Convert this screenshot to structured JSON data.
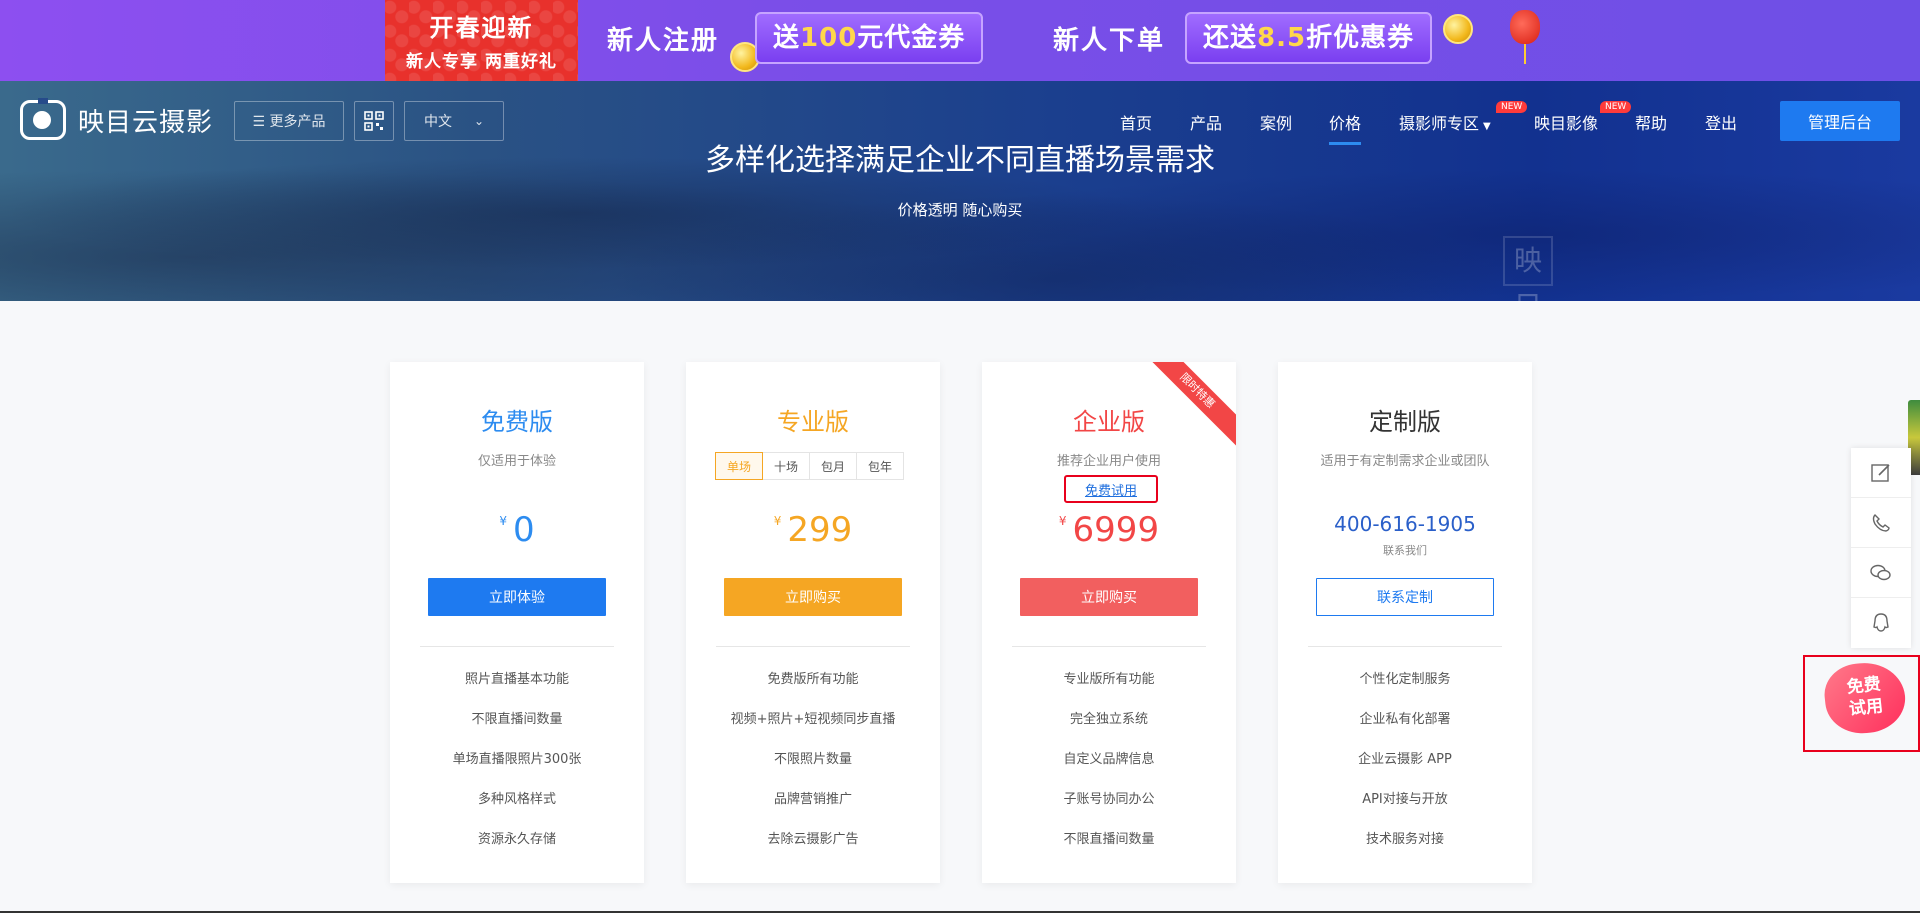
{
  "promo": {
    "badge_line1": "开春迎新",
    "badge_line2": "新人专享  两重好礼",
    "register_text": "新人注册",
    "register_pill_pre": "送",
    "register_pill_hl": "100",
    "register_pill_post": "元代金券",
    "order_text": "新人下单",
    "order_pill_pre": "还送",
    "order_pill_hl": "8.5",
    "order_pill_post": "折优惠券"
  },
  "nav": {
    "logo_text": "映目云摄影",
    "more_products": "☰ 更多产品",
    "qr_icon": "qr-code-icon",
    "language": "中文",
    "items": [
      {
        "label": "首页",
        "active": false
      },
      {
        "label": "产品",
        "active": false
      },
      {
        "label": "案例",
        "active": false
      },
      {
        "label": "价格",
        "active": true
      },
      {
        "label": "摄影师专区",
        "active": false,
        "badge": "NEW"
      },
      {
        "label": "映目影像",
        "active": false,
        "badge": "NEW"
      },
      {
        "label": "帮助",
        "active": false
      },
      {
        "label": "登出",
        "active": false
      }
    ],
    "admin_button": "管理后台"
  },
  "hero": {
    "title": "多样化选择满足企业不同直播场景需求",
    "subtitle": "价格透明 随心购买",
    "watermark": "映目"
  },
  "plans": [
    {
      "title": "免费版",
      "title_color": "#2d8cf0",
      "desc": "仅适用于体验",
      "currency": "¥",
      "price": "0",
      "price_color": "#2d8cf0",
      "button": "立即体验",
      "button_color": "#1e7af0",
      "features": [
        "照片直播基本功能",
        "不限直播间数量",
        "单场直播限照片300张",
        "多种风格样式",
        "资源永久存储"
      ]
    },
    {
      "title": "专业版",
      "title_color": "#f5a623",
      "tabs": [
        "单场",
        "十场",
        "包月",
        "包年"
      ],
      "selected_tab": "单场",
      "currency": "¥",
      "price": "299",
      "price_color": "#f5a623",
      "button": "立即购买",
      "button_color": "#f5a623",
      "features": [
        "免费版所有功能",
        "视频+照片+短视频同步直播",
        "不限照片数量",
        "品牌营销推广",
        "去除云摄影广告"
      ]
    },
    {
      "title": "企业版",
      "title_color": "#f24646",
      "desc": "推荐企业用户使用",
      "trial_link": "免费试用",
      "ribbon": "限时特惠",
      "currency": "¥",
      "price": "6999",
      "price_color": "#f24646",
      "button": "立即购买",
      "button_color": "#f25f5f",
      "features": [
        "专业版所有功能",
        "完全独立系统",
        "自定义品牌信息",
        "子账号协同办公",
        "不限直播间数量"
      ]
    },
    {
      "title": "定制版",
      "title_color": "#333333",
      "desc": "适用于有定制需求企业或团队",
      "phone": "400-616-1905",
      "phone_sub": "联系我们",
      "button": "联系定制",
      "features": [
        "个性化定制服务",
        "企业私有化部署",
        "企业云摄影 APP",
        "API对接与开放",
        "技术服务对接"
      ]
    }
  ],
  "side_tools": {
    "icons": [
      "edit-icon",
      "phone-icon",
      "wechat-icon",
      "qq-icon"
    ],
    "free_trial_line1": "免费",
    "free_trial_line2": "试用"
  }
}
